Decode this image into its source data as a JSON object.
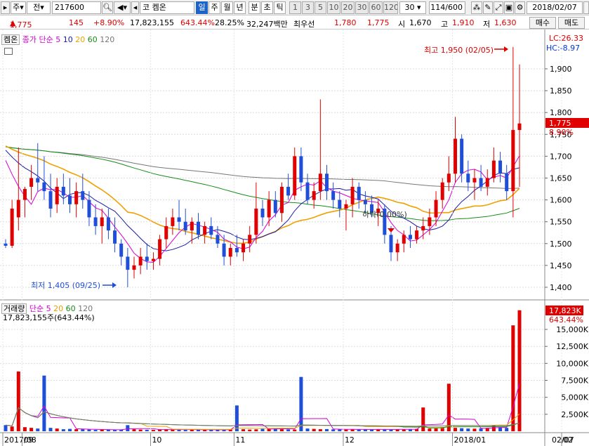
{
  "toolbar": {
    "market": "주",
    "type": "전",
    "code": "217600",
    "name_prefix": "코",
    "name": "켐온",
    "periods": [
      "일",
      "주",
      "월",
      "년",
      "분",
      "초",
      "틱"
    ],
    "period_selected": "일",
    "intervals": [
      "1",
      "3",
      "5",
      "10",
      "20",
      "30",
      "60",
      "120"
    ],
    "custom_interval": "30",
    "count": "114/600",
    "date": "2018/02/07"
  },
  "quote": {
    "price": "1,775",
    "change": "145",
    "change_pct": "+8.90%",
    "volume": "17,823,155",
    "vol_ratio": "643.44%",
    "turnover": "28.25%",
    "amount": "32,247백만",
    "best_label": "최우선",
    "ask": "1,780",
    "bid": "1,775",
    "open_label": "시",
    "open": "1,670",
    "high_label": "고",
    "high": "1,910",
    "low_label": "저",
    "low": "1,630",
    "buy_label": "매수",
    "sell_label": "매도"
  },
  "price_legend": {
    "name": "켐온",
    "ma_label": "종가 단순",
    "periods": [
      "5",
      "10",
      "20",
      "60",
      "120"
    ]
  },
  "lc": "LC:26.33",
  "hc": "HC:-8.97",
  "annotations": {
    "high": "최고 1,950 (02/05)",
    "low": "최저 1,405 (09/25)",
    "drop": "하락(0.00%)"
  },
  "price_tag": "1,775",
  "pct_tag": "8.90%",
  "vol_legend": {
    "name": "거래량",
    "ma_label": "단순",
    "periods": [
      "5",
      "20",
      "60",
      "120"
    ]
  },
  "vol_info": "17,823,155주(643.44%)",
  "vol_tag": "17,823K",
  "vol_pct_tag": "643.44%",
  "x_labels": [
    {
      "i": 0,
      "t": "2017/08"
    },
    {
      "i": 3,
      "t": "09"
    },
    {
      "i": 23,
      "t": "10"
    },
    {
      "i": 36,
      "t": "11"
    },
    {
      "i": 53,
      "t": "12"
    },
    {
      "i": 70,
      "t": "2018/01"
    },
    {
      "i": 87,
      "t": "02"
    }
  ],
  "x_last": "02/07",
  "chart_data": {
    "type": "candlestick",
    "price_axis": {
      "min": 1400,
      "max": 1900,
      "ticks": [
        1400,
        1450,
        1500,
        1550,
        1600,
        1650,
        1700,
        1750,
        1800,
        1850,
        1900
      ]
    },
    "volume_axis": {
      "min": 0,
      "max": 15000,
      "unit": "K",
      "ticks": [
        2500,
        5000,
        7500,
        10000,
        12500,
        15000
      ]
    },
    "colors": {
      "up": "#e00000",
      "down": "#1f4fd8",
      "ma5": "#d400d4",
      "ma10": "#1a1aa6",
      "ma20": "#f0a000",
      "ma60": "#188c18",
      "ma120": "#777777"
    },
    "ohlc": [
      [
        1500,
        1510,
        1490,
        1495
      ],
      [
        1495,
        1600,
        1490,
        1580
      ],
      [
        1560,
        1720,
        1530,
        1600
      ],
      [
        1600,
        1630,
        1560,
        1625
      ],
      [
        1630,
        1680,
        1600,
        1650
      ],
      [
        1650,
        1730,
        1620,
        1640
      ],
      [
        1640,
        1700,
        1600,
        1620
      ],
      [
        1620,
        1660,
        1560,
        1580
      ],
      [
        1590,
        1650,
        1570,
        1630
      ],
      [
        1630,
        1660,
        1590,
        1610
      ],
      [
        1610,
        1650,
        1570,
        1590
      ],
      [
        1590,
        1640,
        1560,
        1620
      ],
      [
        1620,
        1660,
        1580,
        1600
      ],
      [
        1600,
        1620,
        1540,
        1560
      ],
      [
        1560,
        1590,
        1520,
        1540
      ],
      [
        1540,
        1580,
        1500,
        1560
      ],
      [
        1560,
        1580,
        1510,
        1530
      ],
      [
        1530,
        1560,
        1480,
        1500
      ],
      [
        1500,
        1510,
        1450,
        1470
      ],
      [
        1470,
        1490,
        1400,
        1440
      ],
      [
        1440,
        1470,
        1420,
        1450
      ],
      [
        1450,
        1490,
        1430,
        1470
      ],
      [
        1470,
        1500,
        1440,
        1460
      ],
      [
        1460,
        1480,
        1440,
        1465
      ],
      [
        1465,
        1520,
        1450,
        1510
      ],
      [
        1510,
        1560,
        1490,
        1540
      ],
      [
        1540,
        1580,
        1520,
        1560
      ],
      [
        1560,
        1600,
        1530,
        1550
      ],
      [
        1550,
        1580,
        1520,
        1530
      ],
      [
        1530,
        1560,
        1500,
        1550
      ],
      [
        1550,
        1570,
        1510,
        1520
      ],
      [
        1520,
        1550,
        1500,
        1540
      ],
      [
        1540,
        1560,
        1510,
        1520
      ],
      [
        1520,
        1540,
        1490,
        1500
      ],
      [
        1500,
        1520,
        1450,
        1470
      ],
      [
        1470,
        1500,
        1450,
        1490
      ],
      [
        1490,
        1520,
        1470,
        1480
      ],
      [
        1480,
        1510,
        1460,
        1500
      ],
      [
        1500,
        1540,
        1480,
        1520
      ],
      [
        1520,
        1640,
        1500,
        1580
      ],
      [
        1580,
        1600,
        1540,
        1560
      ],
      [
        1560,
        1620,
        1540,
        1600
      ],
      [
        1600,
        1620,
        1560,
        1570
      ],
      [
        1570,
        1640,
        1550,
        1630
      ],
      [
        1630,
        1660,
        1600,
        1610
      ],
      [
        1610,
        1720,
        1600,
        1700
      ],
      [
        1700,
        1720,
        1620,
        1640
      ],
      [
        1640,
        1660,
        1590,
        1600
      ],
      [
        1600,
        1640,
        1580,
        1620
      ],
      [
        1620,
        1830,
        1600,
        1660
      ],
      [
        1660,
        1680,
        1600,
        1620
      ],
      [
        1620,
        1640,
        1580,
        1600
      ],
      [
        1600,
        1620,
        1560,
        1580
      ],
      [
        1580,
        1600,
        1530,
        1590
      ],
      [
        1590,
        1650,
        1560,
        1630
      ],
      [
        1630,
        1640,
        1580,
        1600
      ],
      [
        1600,
        1620,
        1570,
        1590
      ],
      [
        1590,
        1610,
        1560,
        1570
      ],
      [
        1570,
        1600,
        1540,
        1580
      ],
      [
        1580,
        1590,
        1500,
        1520
      ],
      [
        1520,
        1540,
        1460,
        1480
      ],
      [
        1480,
        1510,
        1460,
        1500
      ],
      [
        1500,
        1530,
        1480,
        1520
      ],
      [
        1520,
        1540,
        1490,
        1510
      ],
      [
        1510,
        1540,
        1500,
        1530
      ],
      [
        1530,
        1560,
        1510,
        1540
      ],
      [
        1540,
        1580,
        1520,
        1560
      ],
      [
        1560,
        1620,
        1540,
        1600
      ],
      [
        1600,
        1650,
        1580,
        1640
      ],
      [
        1640,
        1700,
        1620,
        1660
      ],
      [
        1660,
        1790,
        1640,
        1740
      ],
      [
        1740,
        1750,
        1640,
        1660
      ],
      [
        1660,
        1690,
        1620,
        1640
      ],
      [
        1640,
        1670,
        1600,
        1650
      ],
      [
        1650,
        1680,
        1620,
        1630
      ],
      [
        1630,
        1670,
        1610,
        1650
      ],
      [
        1650,
        1720,
        1640,
        1690
      ],
      [
        1690,
        1710,
        1640,
        1660
      ],
      [
        1660,
        1680,
        1600,
        1620
      ],
      [
        1620,
        1950,
        1560,
        1760
      ],
      [
        1760,
        1910,
        1630,
        1775
      ]
    ],
    "volume_k": [
      900,
      700,
      8800,
      600,
      500,
      400,
      8200,
      500,
      400,
      300,
      350,
      300,
      300,
      250,
      200,
      250,
      220,
      200,
      260,
      900,
      300,
      250,
      220,
      200,
      280,
      300,
      250,
      220,
      200,
      260,
      240,
      200,
      220,
      210,
      230,
      250,
      3800,
      300,
      250,
      280,
      350,
      400,
      450,
      300,
      280,
      250,
      8000,
      400,
      350,
      300,
      320,
      280,
      260,
      240,
      300,
      280,
      260,
      240,
      270,
      300,
      250,
      280,
      300,
      320,
      350,
      3500,
      400,
      450,
      600,
      7000,
      500,
      450,
      400,
      380,
      420,
      500,
      800,
      600,
      500,
      15600,
      17823
    ]
  }
}
